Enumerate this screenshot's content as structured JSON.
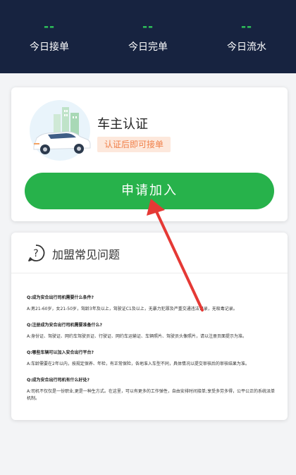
{
  "stats": [
    {
      "value": "--",
      "label": "今日接单"
    },
    {
      "value": "--",
      "label": "今日完单"
    },
    {
      "value": "--",
      "label": "今日流水"
    }
  ],
  "verify": {
    "title": "车主认证",
    "tag": "认证后即可接单",
    "button": "申请加入"
  },
  "faq": {
    "title": "加盟常见问题",
    "items": [
      {
        "q": "Q:成为安合出行司机需要什么条件?",
        "a": "A:男21-60岁，女21-50岁，驾龄3年及以上，驾驶证C1及以上，无暴力犯罪及严重交通违法记录，无吸毒记录。"
      },
      {
        "q": "Q:注册成为安合出行司机需要准备什么?",
        "a": "A:身份证、驾驶证、网约车驾驶员证、行驶证、网约车运输证、车辆照片、驾驶员头像照片，请以注册页面提示为准。"
      },
      {
        "q": "Q:哪些车辆可以加入安合出行平台?",
        "a": "A:车龄需要在2年以内，按规定保养、年检，有正常保险，各地准入车型不同，具体情况以提交审核后的审核结果为准。"
      },
      {
        "q": "Q:成为安合出行司机有什么好处?",
        "a": "A:司机不仅仅是一份职业,更是一种生方式。在这里，可以有更多的工作弹性，自由安排时间接单;享受多劳多得，公平公正的系统派单机制。"
      }
    ]
  },
  "colors": {
    "header_bg": "#172340",
    "accent": "#27b24b",
    "tag_bg": "#fde8dc",
    "tag_text": "#f0804a",
    "arrow": "#e53935"
  }
}
